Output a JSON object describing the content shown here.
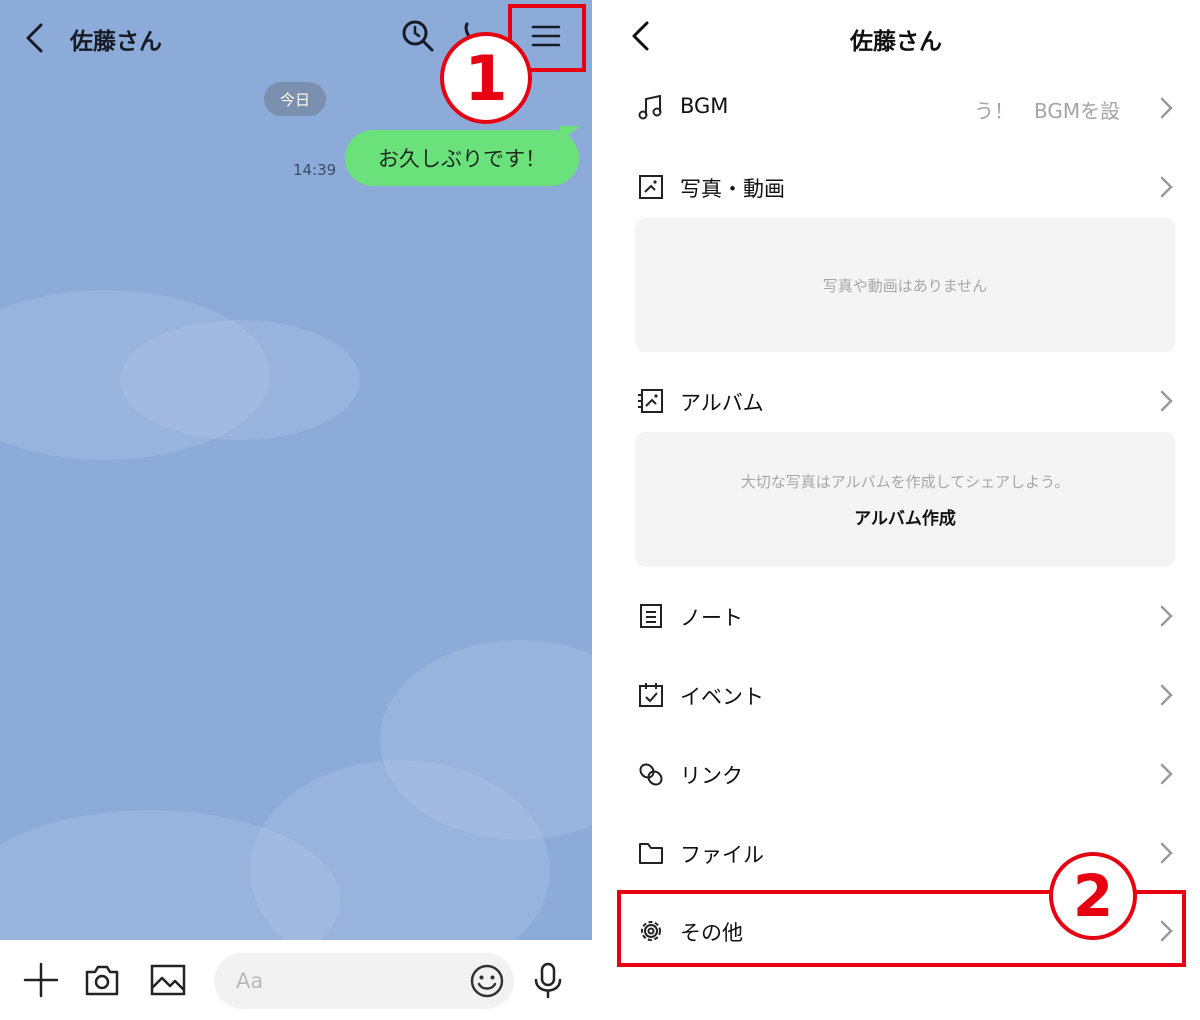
{
  "chat": {
    "title": "佐藤さん",
    "date_label": "今日",
    "messages": [
      {
        "time": "14:39",
        "text": "お久しぶりです！"
      }
    ],
    "input_placeholder": "Aa",
    "badge": "1"
  },
  "settings": {
    "title": "佐藤さん",
    "bgm": {
      "label": "BGM",
      "preview": "う！　BGMを設"
    },
    "photos": {
      "label": "写真・動画",
      "empty_text": "写真や動画はありません"
    },
    "album": {
      "label": "アルバム",
      "empty_text": "大切な写真はアルバムを作成してシェアしよう。",
      "create_label": "アルバム作成"
    },
    "note": {
      "label": "ノート"
    },
    "event": {
      "label": "イベント"
    },
    "link": {
      "label": "リンク"
    },
    "file": {
      "label": "ファイル"
    },
    "other": {
      "label": "その他"
    },
    "badge": "2"
  },
  "colors": {
    "chat_background": "#8dabd8",
    "bubble": "#6ae17b",
    "highlight": "#e60012",
    "empty_box": "#f4f4f4"
  },
  "icons": {
    "chat_header": [
      "back-icon",
      "search-icon",
      "phone-icon",
      "menu-icon"
    ],
    "chat_input": [
      "plus-icon",
      "camera-icon",
      "image-icon",
      "emoji-icon",
      "mic-icon"
    ],
    "settings_rows": [
      "music-note-icon",
      "photo-icon",
      "album-icon",
      "note-icon",
      "calendar-icon",
      "link-icon",
      "folder-icon",
      "gear-icon",
      "chevron-right-icon"
    ]
  }
}
